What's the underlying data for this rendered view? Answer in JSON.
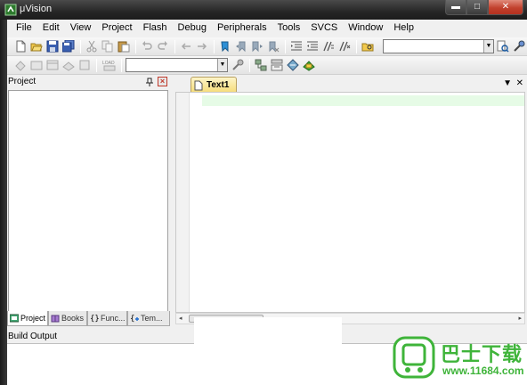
{
  "window": {
    "title": "μVision",
    "controls": {
      "minimize": "▬",
      "maximize": "□",
      "close": "✕"
    }
  },
  "menu": [
    "File",
    "Edit",
    "View",
    "Project",
    "Flash",
    "Debug",
    "Peripherals",
    "Tools",
    "SVCS",
    "Window",
    "Help"
  ],
  "toolbar": {
    "find_combo_value": "",
    "target_combo_value": "",
    "load_label": "LOAD"
  },
  "project_panel": {
    "title": "Project",
    "pin": "ᵖ",
    "close": "×",
    "tabs": [
      {
        "label": "Project",
        "icon": "project-icon"
      },
      {
        "label": "Books",
        "icon": "books-icon"
      },
      {
        "label": "Func...",
        "icon": "functions-icon"
      },
      {
        "label": "Tem...",
        "icon": "templates-icon"
      }
    ]
  },
  "editor": {
    "tabs": [
      {
        "label": "Text1"
      }
    ],
    "tab_list_arrow": "▼",
    "close": "✕",
    "scroll_left": "◂",
    "scroll_right": "▸",
    "content": ""
  },
  "build_output": {
    "title": "Build Output",
    "content": ""
  },
  "watermark": {
    "name": "巴士下载",
    "url": "www.11684.com",
    "brand_color": "#3fb43a"
  }
}
